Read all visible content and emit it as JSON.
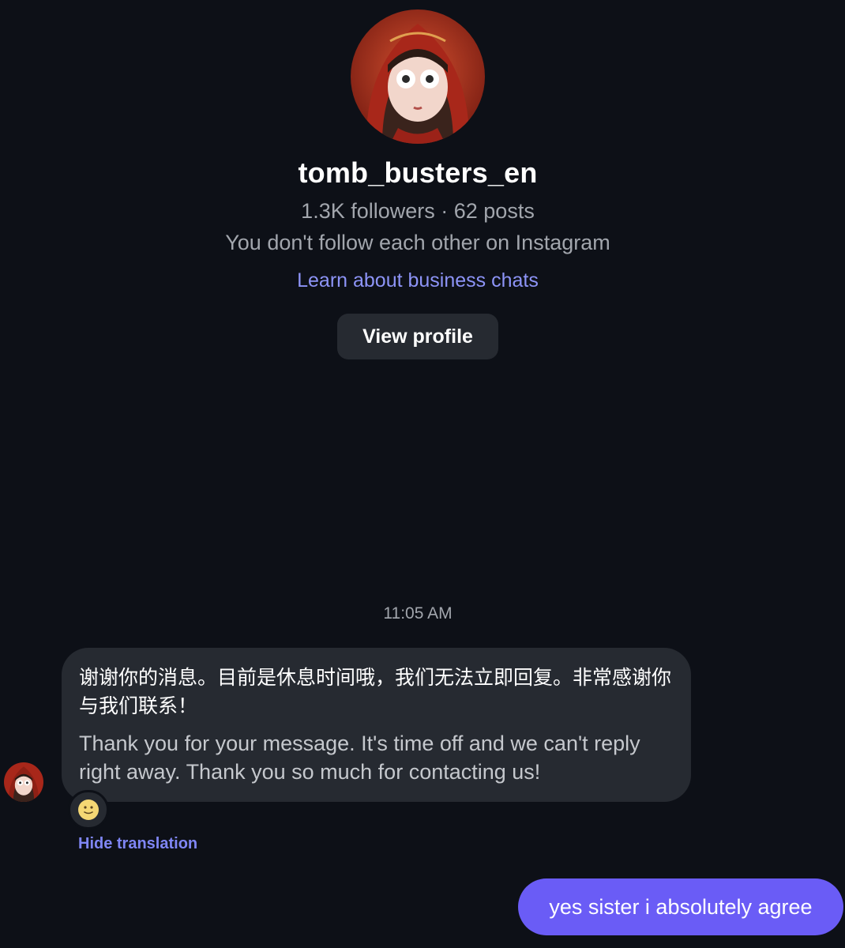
{
  "profile": {
    "username": "tomb_busters_en",
    "stats": "1.3K followers · 62 posts",
    "follow_note": "You don't follow each other on Instagram",
    "learn_link": "Learn about business chats",
    "view_profile_label": "View profile"
  },
  "conversation": {
    "timestamp": "11:05 AM",
    "incoming": {
      "original_text": "谢谢你的消息。目前是休息时间哦，我们无法立即回复。非常感谢你与我们联系！",
      "translated_text": "Thank you for your message. It's time off and we can't reply right away. Thank you so much for contacting us!",
      "reaction_icon": "slightly-smiling-face-emoji",
      "hide_translation_label": "Hide translation"
    },
    "outgoing": {
      "text": "yes sister i absolutely agree"
    }
  },
  "colors": {
    "background": "#0d1017",
    "incoming_bubble": "#262a31",
    "outgoing_bubble": "#6a5cf6",
    "link": "#8d94f7",
    "secondary_text": "#a2a6ad"
  }
}
